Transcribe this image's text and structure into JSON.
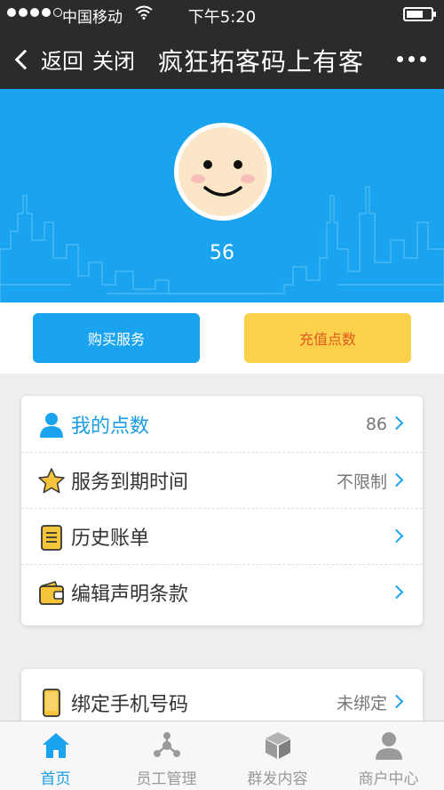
{
  "status_bar": {
    "carrier": "中国移动",
    "time": "下午5:20"
  },
  "nav": {
    "back_label": "返回",
    "close_label": "关闭",
    "title": "疯狂拓客码上有客"
  },
  "profile": {
    "points_value": "56"
  },
  "actions": {
    "buy_label": "购买服务",
    "recharge_label": "充值点数"
  },
  "menu": [
    {
      "label": "我的点数",
      "value": "86",
      "icon": "user-icon"
    },
    {
      "label": "服务到期时间",
      "value": "不限制",
      "icon": "star-icon"
    },
    {
      "label": "历史账单",
      "value": "",
      "icon": "notepad-icon"
    },
    {
      "label": "编辑声明条款",
      "value": "",
      "icon": "wallet-icon"
    }
  ],
  "menu2": [
    {
      "label": "绑定手机号码",
      "value": "未绑定",
      "icon": "phone-icon"
    }
  ],
  "tabs": [
    {
      "label": "首页",
      "icon": "home-icon",
      "active": true
    },
    {
      "label": "员工管理",
      "icon": "share-nodes-icon",
      "active": false
    },
    {
      "label": "群发内容",
      "icon": "cube-icon",
      "active": false
    },
    {
      "label": "商户中心",
      "icon": "person-icon",
      "active": false
    }
  ],
  "colors": {
    "accent": "#1aa3ef",
    "header_bg": "#2b2b2b",
    "recharge_bg": "#fbd14b",
    "recharge_text": "#e05a1f"
  }
}
